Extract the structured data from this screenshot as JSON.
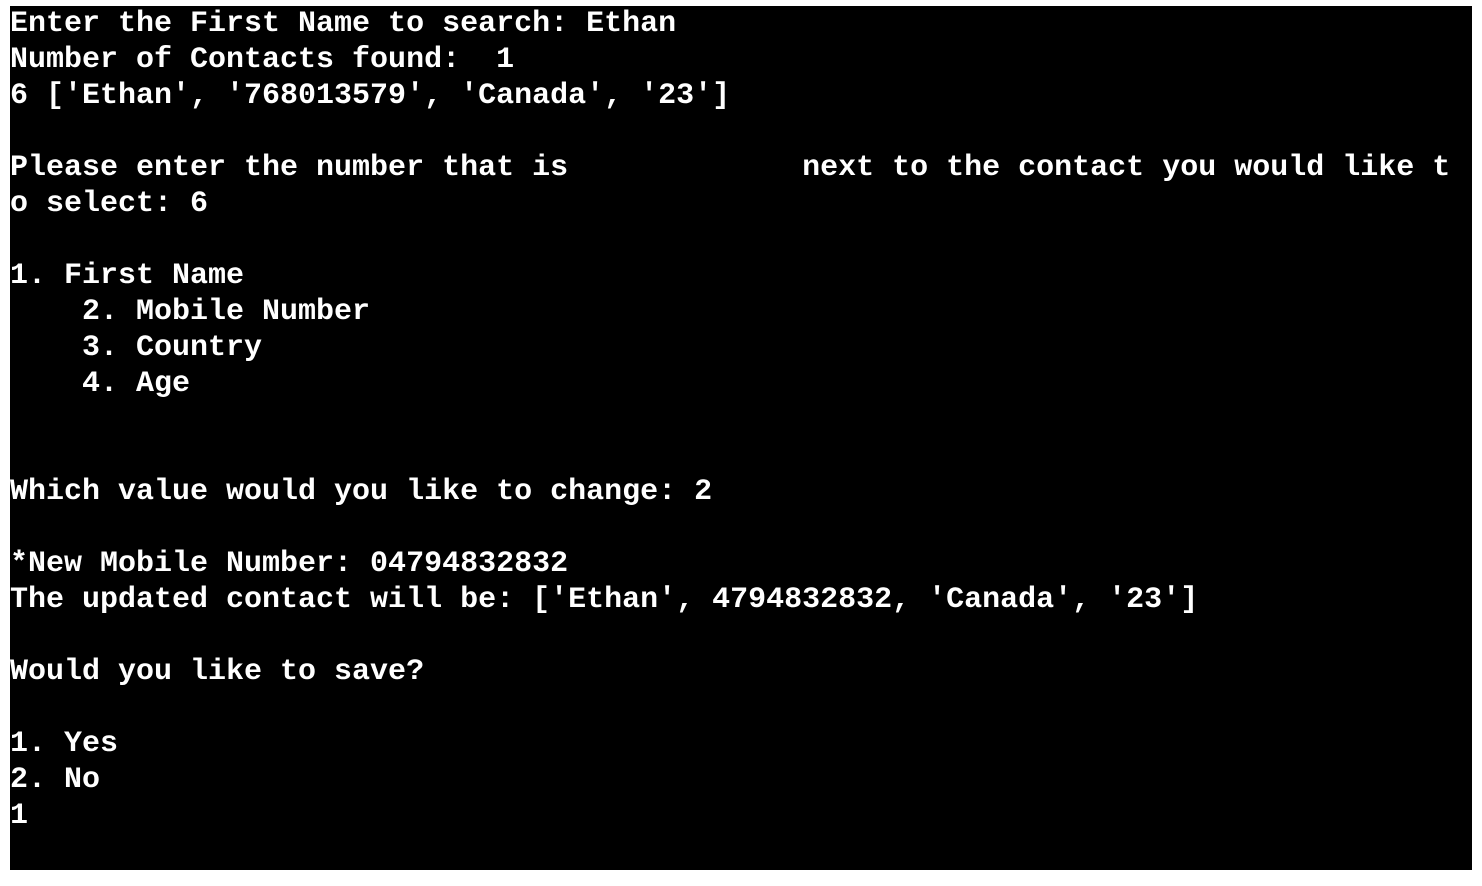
{
  "terminal": {
    "background": "#000000",
    "foreground": "#ffffff",
    "lines": {
      "search_prompt": "Enter the First Name to search: Ethan",
      "contacts_found": "Number of Contacts found:  1",
      "contact_result": "6 ['Ethan', '768013579', 'Canada', '23']",
      "select_prompt_part1": "Please enter the number that is             next to the contact you would like t",
      "select_prompt_part2": "o select: 6",
      "field_option_1": "1. First Name",
      "field_option_2": "2. Mobile Number",
      "field_option_3": "3. Country",
      "field_option_4": "4. Age",
      "change_prompt": "Which value would you like to change: 2",
      "new_mobile_prompt": "*New Mobile Number: 04794832832",
      "updated_contact": "The updated contact will be: ['Ethan', 4794832832, 'Canada', '23']",
      "save_prompt": "Would you like to save?",
      "save_option_1": "1. Yes",
      "save_option_2": "2. No",
      "save_input": "1"
    }
  }
}
